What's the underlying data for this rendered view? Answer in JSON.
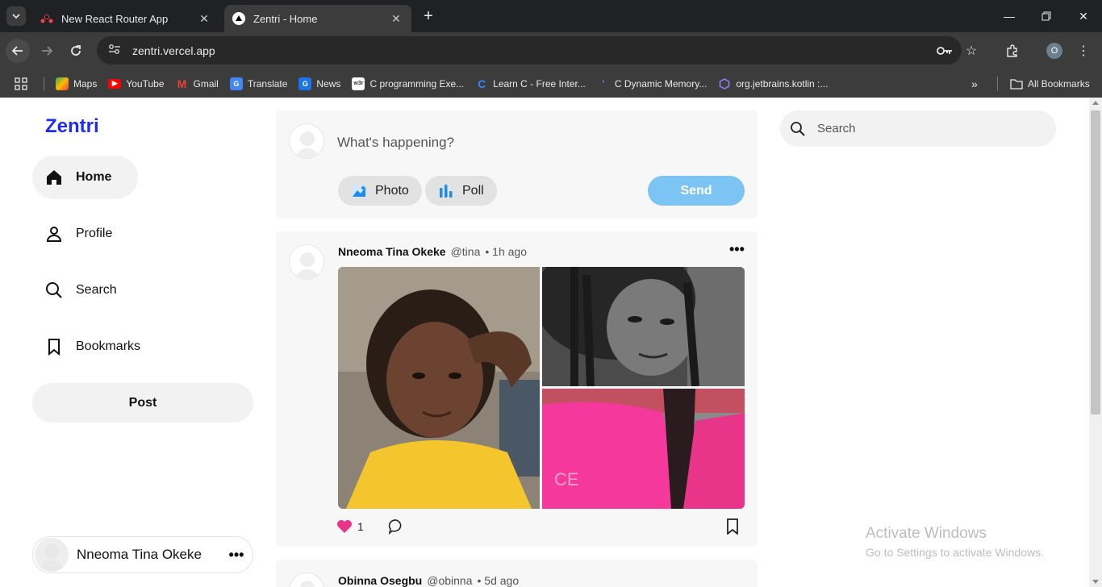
{
  "browser": {
    "tabs": [
      {
        "title": "New React Router App"
      },
      {
        "title": "Zentri - Home"
      }
    ],
    "url": "zentri.vercel.app",
    "profile_initial": "O",
    "bookmarks": [
      {
        "label": "Maps",
        "icon": "maps-icon"
      },
      {
        "label": "YouTube",
        "icon": "youtube-icon"
      },
      {
        "label": "Gmail",
        "icon": "gmail-icon"
      },
      {
        "label": "Translate",
        "icon": "translate-icon"
      },
      {
        "label": "News",
        "icon": "news-icon"
      },
      {
        "label": "C programming Exe...",
        "icon": "w3r-icon"
      },
      {
        "label": "Learn C - Free Inter...",
        "icon": "c-icon"
      },
      {
        "label": "C Dynamic Memory...",
        "icon": "cdm-icon"
      },
      {
        "label": "org.jetbrains.kotlin :...",
        "icon": "hex-icon"
      }
    ],
    "all_bookmarks_label": "All Bookmarks"
  },
  "app": {
    "logo": "Zentri",
    "nav": [
      {
        "label": "Home",
        "active": true
      },
      {
        "label": "Profile",
        "active": false
      },
      {
        "label": "Search",
        "active": false
      },
      {
        "label": "Bookmarks",
        "active": false
      }
    ],
    "post_button": "Post",
    "current_user": "Nneoma Tina Okeke"
  },
  "composer": {
    "placeholder": "What's happening?",
    "photo_label": "Photo",
    "poll_label": "Poll",
    "send_label": "Send"
  },
  "posts": [
    {
      "name": "Nneoma Tina Okeke",
      "handle": "@tina",
      "time": "• 1h ago",
      "likes": "1",
      "liked": true
    },
    {
      "name": "Obinna Osegbu",
      "handle": "@obinna",
      "time": "• 5d ago"
    }
  ],
  "sidebar_search": {
    "placeholder": "Search"
  },
  "watermark": {
    "line1": "Activate Windows",
    "line2": "Go to Settings to activate Windows."
  },
  "colors": {
    "brand": "#1d2cf0",
    "send": "#7cc4f4",
    "like": "#e8358a"
  }
}
